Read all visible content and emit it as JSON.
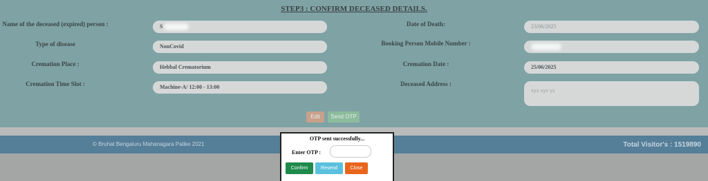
{
  "step_title": "STEP3 : CONFIRM DECEASED DETAILS.",
  "form": {
    "name_label": "Name of the deceased (expired) person :",
    "name_value": "S",
    "disease_label": "Type of disease",
    "disease_value": "NonCovid",
    "place_label": "Cremation Place :",
    "place_value": "Hebbal Crematorium",
    "slot_label": "Cremation Time Slot :",
    "slot_value": "Machine-A/ 12:00 - 13:00",
    "death_date_label": "Date of Death:",
    "death_date_value": "23/06/2025",
    "mobile_label": "Booking Person Mobile Number :",
    "mobile_value": "",
    "cremation_date_label": "Cremation Date :",
    "cremation_date_value": "25/06/2025",
    "address_label": "Deceased Address :",
    "address_value": "xyz xyz yz"
  },
  "actions": {
    "edit_label": "Edit",
    "send_otp_label": "Send OTP"
  },
  "footer": {
    "copyright": "© Bruhat Bengaluru Mahanagara Palike 2021",
    "visitors": "Total Visitor's : 1519890"
  },
  "otp_modal": {
    "message": "OTP sent successfully...",
    "otp_label": "Enter OTP :",
    "otp_value": "",
    "confirm_label": "Confirm",
    "resend_label": "Resend",
    "close_label": "Close"
  },
  "colors": {
    "panel": "#7fa3a5",
    "footer": "#557e99",
    "confirm": "#1e8a4c",
    "resend": "#5bc0de",
    "close": "#e8651c"
  }
}
